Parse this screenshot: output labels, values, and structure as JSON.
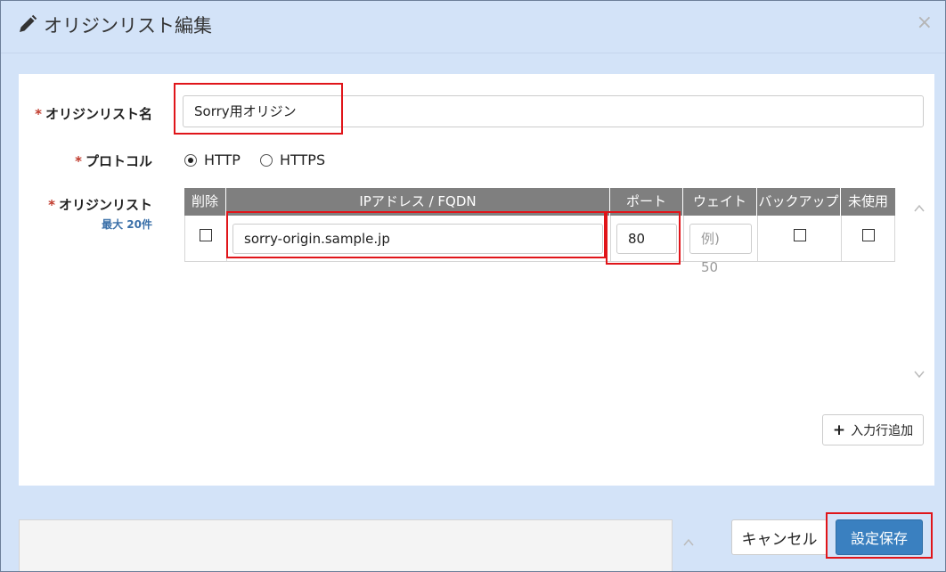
{
  "dialog": {
    "title": "オリジンリスト編集",
    "close_glyph": "×"
  },
  "form": {
    "name_label": "オリジンリスト名",
    "name_value": "Sorry用オリジン",
    "protocol_label": "プロトコル",
    "protocol_options": [
      {
        "label": "HTTP",
        "selected": true
      },
      {
        "label": "HTTPS",
        "selected": false
      }
    ],
    "list_label": "オリジンリスト",
    "list_sublabel": "最大 20件",
    "required_mark": "*"
  },
  "table": {
    "headers": [
      "削除",
      "IPアドレス / FQDN",
      "ポート",
      "ウェイト",
      "バックアップ",
      "未使用"
    ],
    "rows": [
      {
        "delete": false,
        "host": "sorry-origin.sample.jp",
        "port": "80",
        "weight_placeholder": "例) 50",
        "backup": false,
        "unused": false
      }
    ]
  },
  "buttons": {
    "add_row": "入力行追加",
    "add_row_icon": "plus-icon",
    "cancel": "キャンセル",
    "save": "設定保存"
  },
  "colors": {
    "header_bg": "#d3e3f8",
    "table_header": "#7f7f7f",
    "highlight": "#e0151a",
    "primary": "#3a80c0",
    "required": "#c0392b"
  }
}
